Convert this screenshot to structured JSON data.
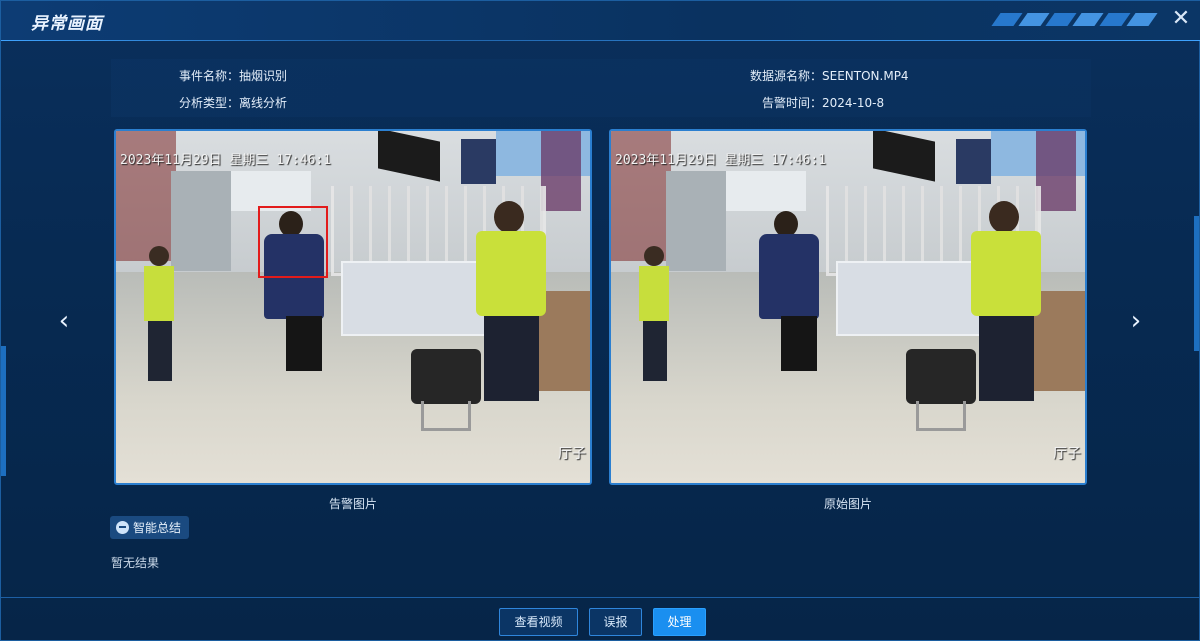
{
  "dialog": {
    "title": "异常画面"
  },
  "info": {
    "event_label": "事件名称：",
    "event_value": "抽烟识别",
    "source_label": "数据源名称：",
    "source_value": "SEENTON.MP4",
    "type_label": "分析类型：",
    "type_value": "离线分析",
    "time_label": "告警时间：",
    "time_value": "2024-10-8"
  },
  "images": {
    "alarm_caption": "告警图片",
    "original_caption": "原始图片",
    "timestamp": "2023年11月29日 星期三 17:46:1",
    "watermark": "厅子"
  },
  "summary": {
    "label": "智能总结",
    "result": "暂无结果"
  },
  "footer": {
    "view_video": "查看视频",
    "false_alarm": "误报",
    "handle": "处理"
  },
  "colors": {
    "accent": "#1a8ff0",
    "detect_box": "#e21b1b",
    "background": "#062447"
  }
}
